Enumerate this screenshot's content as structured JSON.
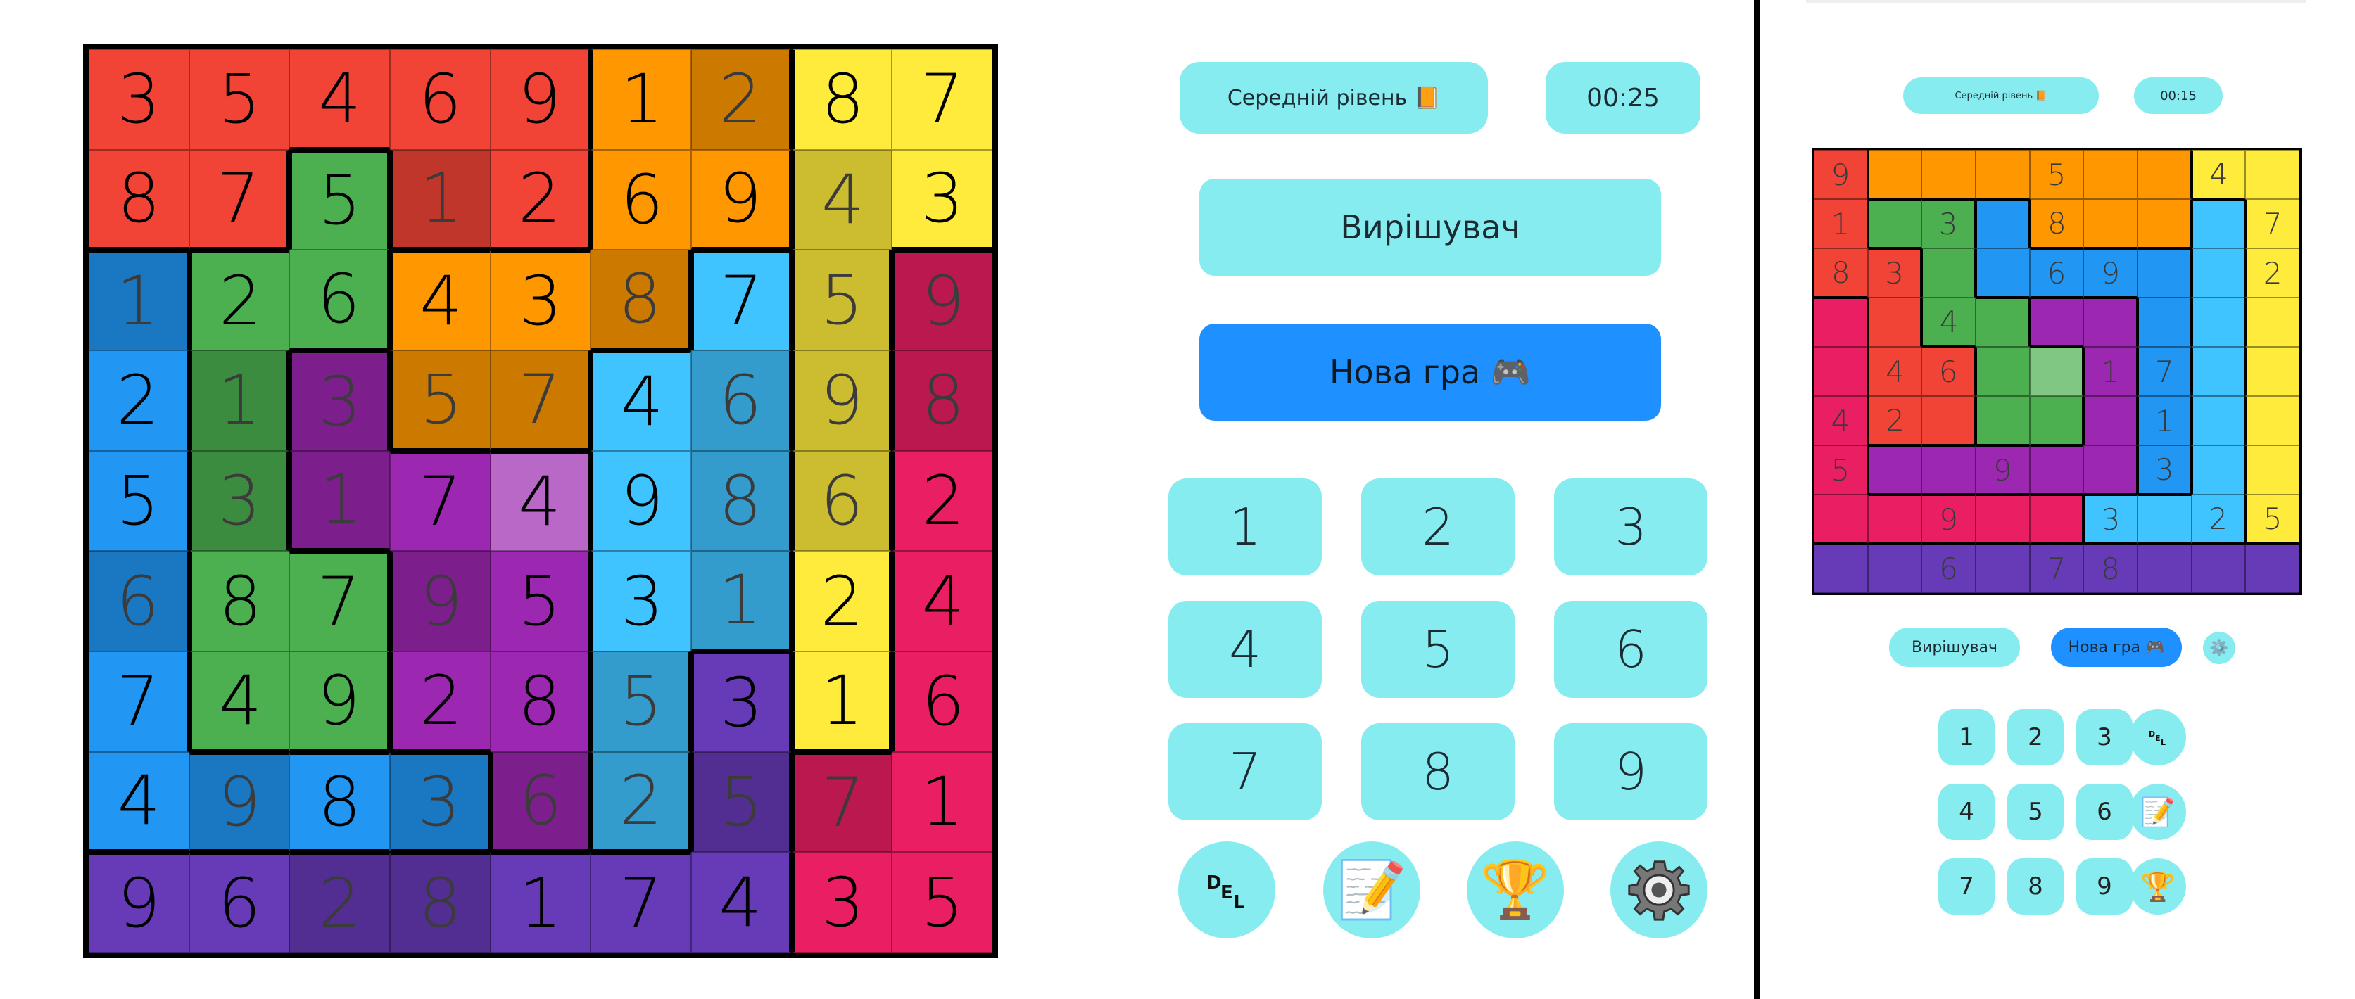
{
  "colors": {
    "red": "#f24436",
    "orange": "#ff9800",
    "yellow": "#ffeb3b",
    "green": "#4caf50",
    "blue": "#2196f3",
    "lightblue": "#40c4ff",
    "purple": "#9c27b0",
    "violet": "#673ab7",
    "pink": "#e91e63",
    "highlight_purple": "#ba68c8",
    "highlight_green": "#81c784",
    "accent": "#86ecef",
    "primary_button": "#1e90ff"
  },
  "main_board": {
    "rows": [
      [
        {
          "v": "3",
          "c": "red",
          "t": "user"
        },
        {
          "v": "5",
          "c": "red",
          "t": "user"
        },
        {
          "v": "4",
          "c": "red",
          "t": "user"
        },
        {
          "v": "6",
          "c": "red",
          "t": "user"
        },
        {
          "v": "9",
          "c": "red",
          "t": "user"
        },
        {
          "v": "1",
          "c": "orange",
          "t": "user"
        },
        {
          "v": "2",
          "c": "orange",
          "t": "hint"
        },
        {
          "v": "8",
          "c": "yellow",
          "t": "user"
        },
        {
          "v": "7",
          "c": "yellow",
          "t": "user"
        }
      ],
      [
        {
          "v": "8",
          "c": "red",
          "t": "user"
        },
        {
          "v": "7",
          "c": "red",
          "t": "user"
        },
        {
          "v": "5",
          "c": "green",
          "t": "user"
        },
        {
          "v": "1",
          "c": "red",
          "t": "hint"
        },
        {
          "v": "2",
          "c": "red",
          "t": "user"
        },
        {
          "v": "6",
          "c": "orange",
          "t": "user"
        },
        {
          "v": "9",
          "c": "orange",
          "t": "user"
        },
        {
          "v": "4",
          "c": "yellow",
          "t": "hint"
        },
        {
          "v": "3",
          "c": "yellow",
          "t": "user"
        }
      ],
      [
        {
          "v": "1",
          "c": "blue",
          "t": "hint"
        },
        {
          "v": "2",
          "c": "green",
          "t": "user"
        },
        {
          "v": "6",
          "c": "green",
          "t": "user"
        },
        {
          "v": "4",
          "c": "orange",
          "t": "user"
        },
        {
          "v": "3",
          "c": "orange",
          "t": "user"
        },
        {
          "v": "8",
          "c": "orange",
          "t": "hint"
        },
        {
          "v": "7",
          "c": "lightblue",
          "t": "user"
        },
        {
          "v": "5",
          "c": "yellow",
          "t": "hint"
        },
        {
          "v": "9",
          "c": "pink",
          "t": "hint"
        }
      ],
      [
        {
          "v": "2",
          "c": "blue",
          "t": "user"
        },
        {
          "v": "1",
          "c": "green",
          "t": "hint"
        },
        {
          "v": "3",
          "c": "purple",
          "t": "hint"
        },
        {
          "v": "5",
          "c": "orange",
          "t": "hint"
        },
        {
          "v": "7",
          "c": "orange",
          "t": "hint"
        },
        {
          "v": "4",
          "c": "lightblue",
          "t": "user"
        },
        {
          "v": "6",
          "c": "lightblue",
          "t": "hint"
        },
        {
          "v": "9",
          "c": "yellow",
          "t": "hint"
        },
        {
          "v": "8",
          "c": "pink",
          "t": "hint"
        }
      ],
      [
        {
          "v": "5",
          "c": "blue",
          "t": "user"
        },
        {
          "v": "3",
          "c": "green",
          "t": "hint"
        },
        {
          "v": "1",
          "c": "purple",
          "t": "hint"
        },
        {
          "v": "7",
          "c": "purple",
          "t": "user"
        },
        {
          "v": "4",
          "c": "highlight_purple",
          "t": "user"
        },
        {
          "v": "9",
          "c": "lightblue",
          "t": "user"
        },
        {
          "v": "8",
          "c": "lightblue",
          "t": "hint"
        },
        {
          "v": "6",
          "c": "yellow",
          "t": "hint"
        },
        {
          "v": "2",
          "c": "pink",
          "t": "user"
        }
      ],
      [
        {
          "v": "6",
          "c": "blue",
          "t": "hint"
        },
        {
          "v": "8",
          "c": "green",
          "t": "user"
        },
        {
          "v": "7",
          "c": "green",
          "t": "user"
        },
        {
          "v": "9",
          "c": "purple",
          "t": "hint"
        },
        {
          "v": "5",
          "c": "purple",
          "t": "user"
        },
        {
          "v": "3",
          "c": "lightblue",
          "t": "user"
        },
        {
          "v": "1",
          "c": "lightblue",
          "t": "hint"
        },
        {
          "v": "2",
          "c": "yellow",
          "t": "user"
        },
        {
          "v": "4",
          "c": "pink",
          "t": "user"
        }
      ],
      [
        {
          "v": "7",
          "c": "blue",
          "t": "user"
        },
        {
          "v": "4",
          "c": "green",
          "t": "user"
        },
        {
          "v": "9",
          "c": "green",
          "t": "user"
        },
        {
          "v": "2",
          "c": "purple",
          "t": "user"
        },
        {
          "v": "8",
          "c": "purple",
          "t": "user"
        },
        {
          "v": "5",
          "c": "lightblue",
          "t": "hint"
        },
        {
          "v": "3",
          "c": "violet",
          "t": "user"
        },
        {
          "v": "1",
          "c": "yellow",
          "t": "user"
        },
        {
          "v": "6",
          "c": "pink",
          "t": "user"
        }
      ],
      [
        {
          "v": "4",
          "c": "blue",
          "t": "user"
        },
        {
          "v": "9",
          "c": "blue",
          "t": "hint"
        },
        {
          "v": "8",
          "c": "blue",
          "t": "user"
        },
        {
          "v": "3",
          "c": "blue",
          "t": "hint"
        },
        {
          "v": "6",
          "c": "purple",
          "t": "hint"
        },
        {
          "v": "2",
          "c": "lightblue",
          "t": "hint"
        },
        {
          "v": "5",
          "c": "violet",
          "t": "hint"
        },
        {
          "v": "7",
          "c": "pink",
          "t": "hint"
        },
        {
          "v": "1",
          "c": "pink",
          "t": "user"
        }
      ],
      [
        {
          "v": "9",
          "c": "violet",
          "t": "user"
        },
        {
          "v": "6",
          "c": "violet",
          "t": "user"
        },
        {
          "v": "2",
          "c": "violet",
          "t": "hint"
        },
        {
          "v": "8",
          "c": "violet",
          "t": "hint"
        },
        {
          "v": "1",
          "c": "violet",
          "t": "user"
        },
        {
          "v": "7",
          "c": "violet",
          "t": "user"
        },
        {
          "v": "4",
          "c": "violet",
          "t": "user"
        },
        {
          "v": "3",
          "c": "pink",
          "t": "user"
        },
        {
          "v": "5",
          "c": "pink",
          "t": "user"
        }
      ]
    ]
  },
  "controls": {
    "difficulty": "Середній рівень 📙",
    "timer": "00:25",
    "solver_label": "Вирішувач",
    "new_game_label": "Нова гра 🎮",
    "numbers": [
      "1",
      "2",
      "3",
      "4",
      "5",
      "6",
      "7",
      "8",
      "9"
    ],
    "notes_icon": "📝",
    "trophy_icon": "🏆",
    "settings_icon": "⚙️"
  },
  "preview": {
    "difficulty": "Середній рівень 📙",
    "timer": "00:15",
    "solver_label": "Вирішувач",
    "new_game_label": "Нова гра 🎮",
    "numbers": [
      "1",
      "2",
      "3",
      "4",
      "5",
      "6",
      "7",
      "8",
      "9"
    ],
    "rows": [
      [
        {
          "v": "9",
          "c": "red"
        },
        {
          "v": "",
          "c": "orange"
        },
        {
          "v": "",
          "c": "orange"
        },
        {
          "v": "",
          "c": "orange"
        },
        {
          "v": "5",
          "c": "orange"
        },
        {
          "v": "",
          "c": "orange"
        },
        {
          "v": "",
          "c": "orange"
        },
        {
          "v": "4",
          "c": "yellow"
        },
        {
          "v": "",
          "c": "yellow"
        }
      ],
      [
        {
          "v": "1",
          "c": "red"
        },
        {
          "v": "",
          "c": "green"
        },
        {
          "v": "3",
          "c": "green"
        },
        {
          "v": "",
          "c": "blue"
        },
        {
          "v": "8",
          "c": "orange"
        },
        {
          "v": "",
          "c": "orange"
        },
        {
          "v": "",
          "c": "orange"
        },
        {
          "v": "",
          "c": "lightblue"
        },
        {
          "v": "7",
          "c": "yellow"
        }
      ],
      [
        {
          "v": "8",
          "c": "red"
        },
        {
          "v": "3",
          "c": "red"
        },
        {
          "v": "",
          "c": "green"
        },
        {
          "v": "",
          "c": "blue"
        },
        {
          "v": "6",
          "c": "blue"
        },
        {
          "v": "9",
          "c": "blue"
        },
        {
          "v": "",
          "c": "blue"
        },
        {
          "v": "",
          "c": "lightblue"
        },
        {
          "v": "2",
          "c": "yellow"
        }
      ],
      [
        {
          "v": "",
          "c": "pink"
        },
        {
          "v": "",
          "c": "red"
        },
        {
          "v": "4",
          "c": "green"
        },
        {
          "v": "",
          "c": "green"
        },
        {
          "v": "",
          "c": "purple"
        },
        {
          "v": "",
          "c": "purple"
        },
        {
          "v": "",
          "c": "blue"
        },
        {
          "v": "",
          "c": "lightblue"
        },
        {
          "v": "",
          "c": "yellow"
        }
      ],
      [
        {
          "v": "",
          "c": "pink"
        },
        {
          "v": "4",
          "c": "red"
        },
        {
          "v": "6",
          "c": "red"
        },
        {
          "v": "",
          "c": "green"
        },
        {
          "v": "",
          "c": "highlight_green"
        },
        {
          "v": "1",
          "c": "purple"
        },
        {
          "v": "7",
          "c": "blue"
        },
        {
          "v": "",
          "c": "lightblue"
        },
        {
          "v": "",
          "c": "yellow"
        }
      ],
      [
        {
          "v": "4",
          "c": "pink"
        },
        {
          "v": "2",
          "c": "red"
        },
        {
          "v": "",
          "c": "red"
        },
        {
          "v": "",
          "c": "green"
        },
        {
          "v": "",
          "c": "green"
        },
        {
          "v": "",
          "c": "purple"
        },
        {
          "v": "1",
          "c": "blue"
        },
        {
          "v": "",
          "c": "lightblue"
        },
        {
          "v": "",
          "c": "yellow"
        }
      ],
      [
        {
          "v": "5",
          "c": "pink"
        },
        {
          "v": "",
          "c": "purple"
        },
        {
          "v": "",
          "c": "purple"
        },
        {
          "v": "9",
          "c": "purple"
        },
        {
          "v": "",
          "c": "purple"
        },
        {
          "v": "",
          "c": "purple"
        },
        {
          "v": "3",
          "c": "blue"
        },
        {
          "v": "",
          "c": "lightblue"
        },
        {
          "v": "",
          "c": "yellow"
        }
      ],
      [
        {
          "v": "",
          "c": "pink"
        },
        {
          "v": "",
          "c": "pink"
        },
        {
          "v": "9",
          "c": "pink"
        },
        {
          "v": "",
          "c": "pink"
        },
        {
          "v": "",
          "c": "pink"
        },
        {
          "v": "3",
          "c": "lightblue"
        },
        {
          "v": "",
          "c": "lightblue"
        },
        {
          "v": "2",
          "c": "lightblue"
        },
        {
          "v": "5",
          "c": "yellow"
        }
      ],
      [
        {
          "v": "",
          "c": "violet"
        },
        {
          "v": "",
          "c": "violet"
        },
        {
          "v": "6",
          "c": "violet"
        },
        {
          "v": "",
          "c": "violet"
        },
        {
          "v": "7",
          "c": "violet"
        },
        {
          "v": "8",
          "c": "violet"
        },
        {
          "v": "",
          "c": "violet"
        },
        {
          "v": "",
          "c": "violet"
        },
        {
          "v": "",
          "c": "violet"
        }
      ]
    ]
  }
}
